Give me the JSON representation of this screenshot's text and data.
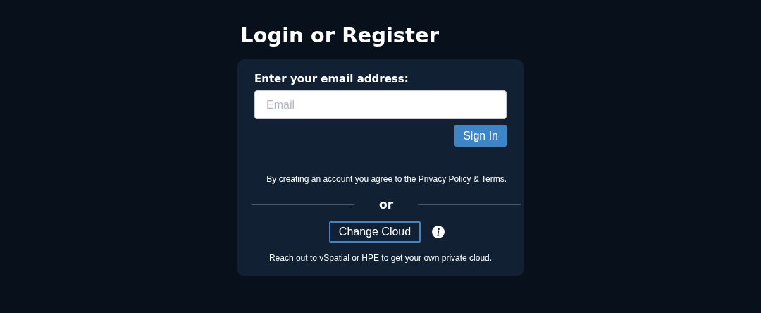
{
  "title": "Login or Register",
  "form": {
    "label": "Enter your email address:",
    "email": {
      "placeholder": "Email"
    },
    "submit": "Sign In"
  },
  "legal": {
    "before": "By creating an account you agree to the ",
    "link_1": "Privacy Policy",
    "middle": " & ",
    "link_2": "Terms",
    "after": "."
  },
  "divider": "or",
  "cloud_button": "Change Cloud",
  "footer": {
    "before": "Reach out to ",
    "link_1": "vSpatial",
    "middle": " or ",
    "link_2": "HPE",
    "after": " to get your own private cloud."
  }
}
